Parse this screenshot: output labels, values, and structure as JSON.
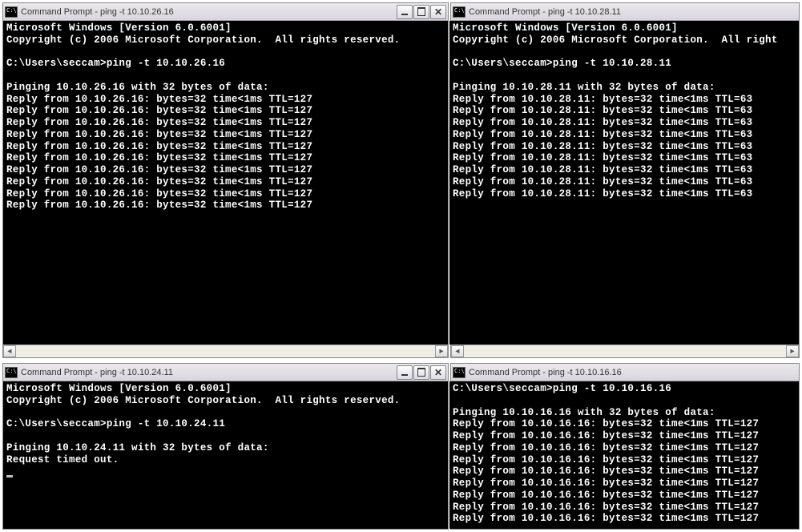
{
  "windows": [
    {
      "id": "win1",
      "title": "Command Prompt - ping  -t 10.10.26.16",
      "show_header": true,
      "show_controls": true,
      "show_scrollbar": true,
      "header1": "Microsoft Windows [Version 6.0.6001]",
      "header2": "Copyright (c) 2006 Microsoft Corporation.  All rights reserved.",
      "prompt": "C:\\Users\\seccam>ping -t 10.10.26.16",
      "pinging": "Pinging 10.10.26.16 with 32 bytes of data:",
      "replies": [
        "Reply from 10.10.26.16: bytes=32 time<1ms TTL=127",
        "Reply from 10.10.26.16: bytes=32 time<1ms TTL=127",
        "Reply from 10.10.26.16: bytes=32 time<1ms TTL=127",
        "Reply from 10.10.26.16: bytes=32 time<1ms TTL=127",
        "Reply from 10.10.26.16: bytes=32 time<1ms TTL=127",
        "Reply from 10.10.26.16: bytes=32 time<1ms TTL=127",
        "Reply from 10.10.26.16: bytes=32 time<1ms TTL=127",
        "Reply from 10.10.26.16: bytes=32 time<1ms TTL=127",
        "Reply from 10.10.26.16: bytes=32 time<1ms TTL=127",
        "Reply from 10.10.26.16: bytes=32 time<1ms TTL=127"
      ],
      "timeout": ""
    },
    {
      "id": "win2",
      "title": "Command Prompt - ping  -t 10.10.28.11",
      "show_header": true,
      "show_controls": false,
      "show_scrollbar": true,
      "header1": "Microsoft Windows [Version 6.0.6001]",
      "header2": "Copyright (c) 2006 Microsoft Corporation.  All right",
      "prompt": "C:\\Users\\seccam>ping -t 10.10.28.11",
      "pinging": "Pinging 10.10.28.11 with 32 bytes of data:",
      "replies": [
        "Reply from 10.10.28.11: bytes=32 time<1ms TTL=63",
        "Reply from 10.10.28.11: bytes=32 time<1ms TTL=63",
        "Reply from 10.10.28.11: bytes=32 time<1ms TTL=63",
        "Reply from 10.10.28.11: bytes=32 time<1ms TTL=63",
        "Reply from 10.10.28.11: bytes=32 time<1ms TTL=63",
        "Reply from 10.10.28.11: bytes=32 time<1ms TTL=63",
        "Reply from 10.10.28.11: bytes=32 time<1ms TTL=63",
        "Reply from 10.10.28.11: bytes=32 time<1ms TTL=63",
        "Reply from 10.10.28.11: bytes=32 time<1ms TTL=63"
      ],
      "timeout": ""
    },
    {
      "id": "win3",
      "title": "Command Prompt - ping  -t 10.10.24.11",
      "show_header": true,
      "show_controls": true,
      "show_scrollbar": false,
      "header1": "Microsoft Windows [Version 6.0.6001]",
      "header2": "Copyright (c) 2006 Microsoft Corporation.  All rights reserved.",
      "prompt": "C:\\Users\\seccam>ping -t 10.10.24.11",
      "pinging": "Pinging 10.10.24.11 with 32 bytes of data:",
      "replies": [],
      "timeout": "Request timed out."
    },
    {
      "id": "win4",
      "title": "Command Prompt - ping  -t 10.10.16.16",
      "show_header": false,
      "show_controls": false,
      "show_scrollbar": false,
      "header1": "",
      "header2": "",
      "prompt": "C:\\Users\\seccam>ping -t 10.10.16.16",
      "pinging": "Pinging 10.10.16.16 with 32 bytes of data:",
      "replies": [
        "Reply from 10.10.16.16: bytes=32 time<1ms TTL=127",
        "Reply from 10.10.16.16: bytes=32 time<1ms TTL=127",
        "Reply from 10.10.16.16: bytes=32 time<1ms TTL=127",
        "Reply from 10.10.16.16: bytes=32 time<1ms TTL=127",
        "Reply from 10.10.16.16: bytes=32 time<1ms TTL=127",
        "Reply from 10.10.16.16: bytes=32 time<1ms TTL=127",
        "Reply from 10.10.16.16: bytes=32 time<1ms TTL=127",
        "Reply from 10.10.16.16: bytes=32 time<1ms TTL=127",
        "Reply from 10.10.16.16: bytes=32 time<1ms TTL=127"
      ],
      "timeout": ""
    }
  ]
}
